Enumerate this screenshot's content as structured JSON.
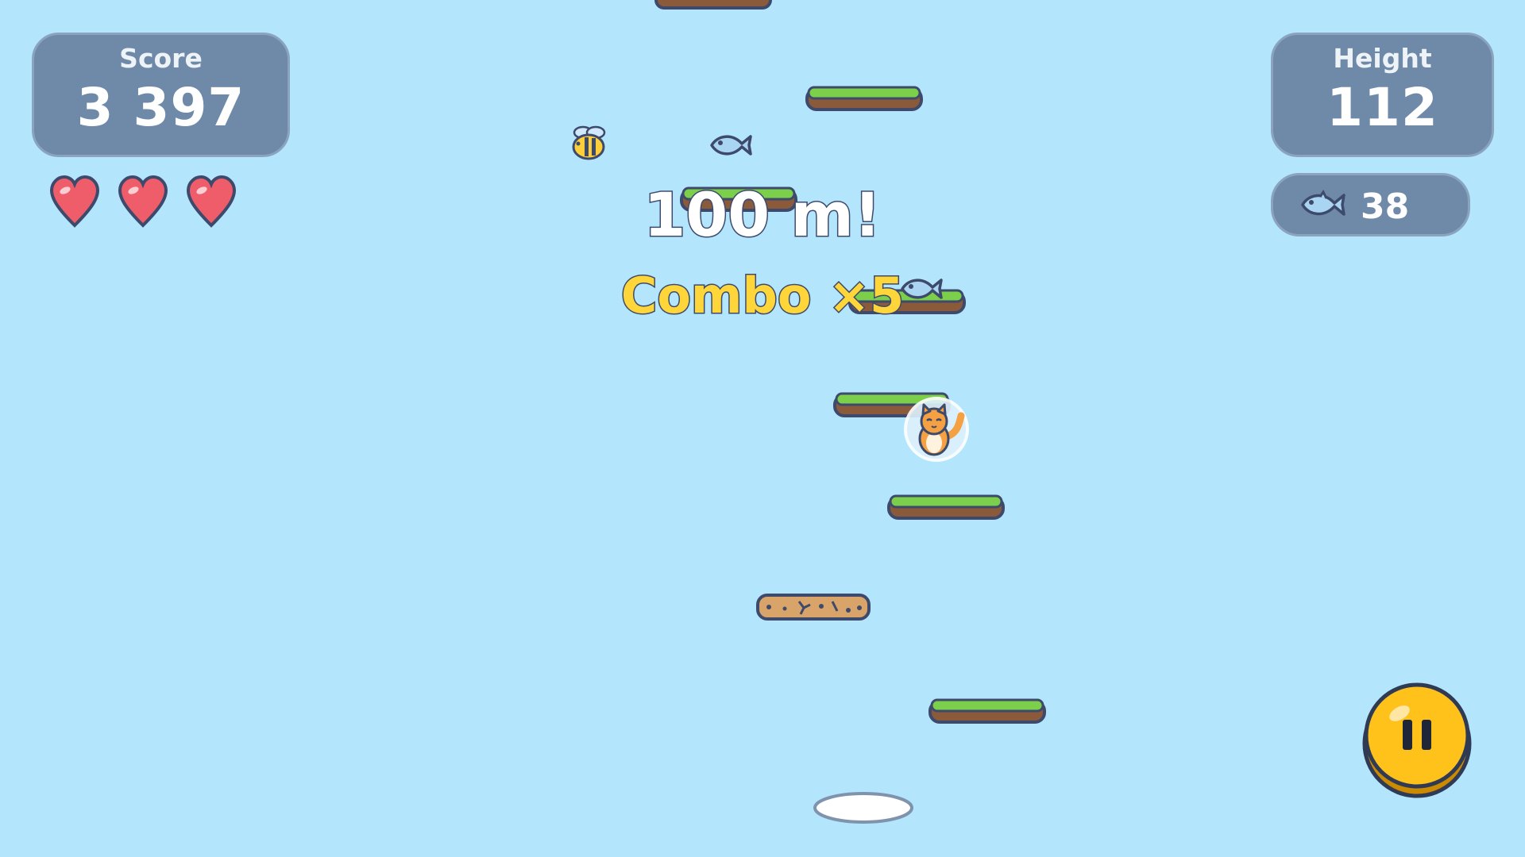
{
  "hud": {
    "score_label": "Score",
    "score_value": "3 397",
    "height_label": "Height",
    "height_value": "112",
    "fish_count": "38",
    "lives": 3
  },
  "messages": {
    "milestone": "100 m!",
    "combo": "Combo ×5"
  },
  "platforms": [
    {
      "type": "grass"
    },
    {
      "type": "grass"
    },
    {
      "type": "grass"
    },
    {
      "type": "grass"
    },
    {
      "type": "grass"
    },
    {
      "type": "grass"
    },
    {
      "type": "grass"
    },
    {
      "type": "crumbling-dirt"
    },
    {
      "type": "cloud"
    }
  ],
  "colors": {
    "sky": "#b3e5fc",
    "panel": "#6f8aa8",
    "combo": "#ffd63a",
    "heart": "#ef5d6a",
    "pause": "#ffc21a"
  },
  "icons": [
    "heart-icon",
    "fish-icon",
    "bee-icon",
    "cat-player",
    "pause-icon"
  ]
}
